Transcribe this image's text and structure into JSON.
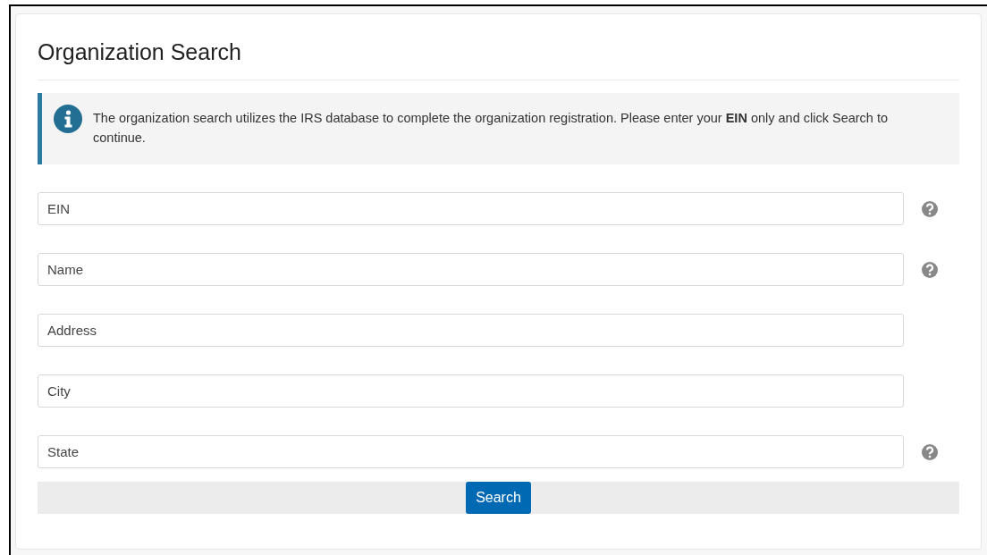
{
  "title": "Organization Search",
  "notice": {
    "text": "The organization search utilizes the IRS database to complete the organization registration. Please enter your **EIN** only and click Search to continue."
  },
  "fields": [
    {
      "placeholder": "EIN",
      "help": true
    },
    {
      "placeholder": "Name",
      "help": true
    },
    {
      "placeholder": "Address",
      "help": false
    },
    {
      "placeholder": "City",
      "help": false
    },
    {
      "placeholder": "State",
      "help": true
    }
  ],
  "button": "Search"
}
